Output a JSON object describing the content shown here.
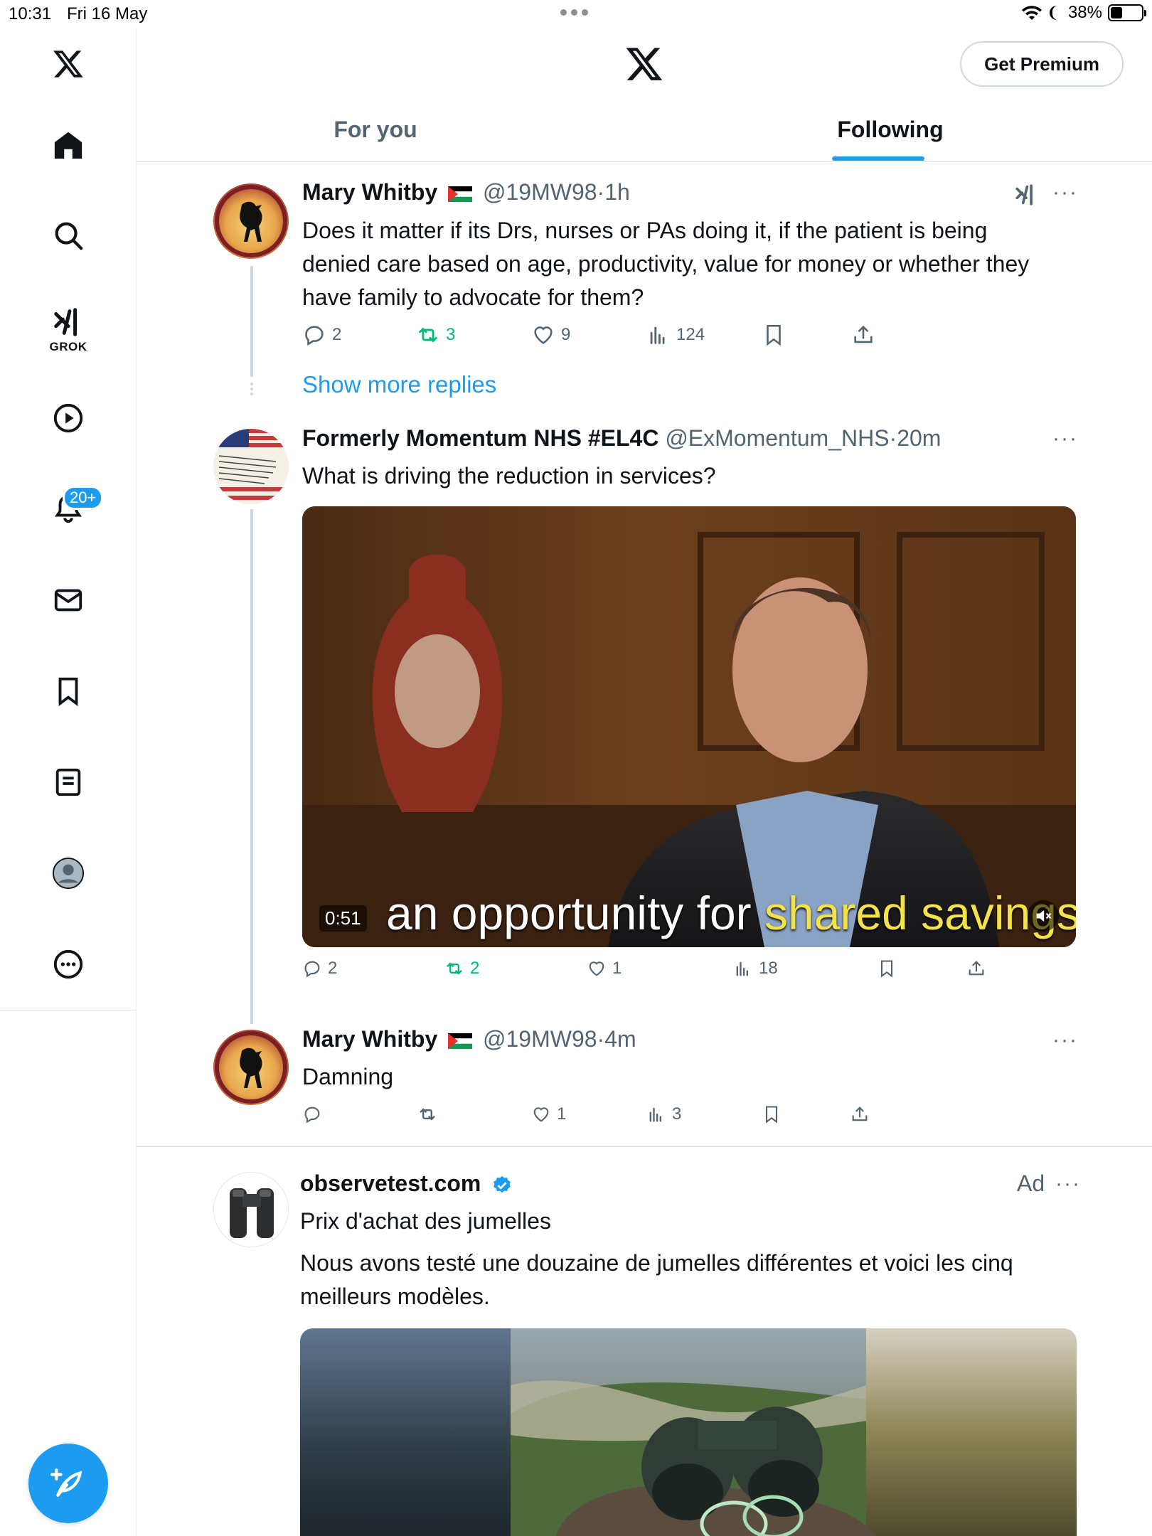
{
  "status_bar": {
    "time": "10:31",
    "date": "Fri 16 May",
    "battery": "38%",
    "battery_level": 0.38
  },
  "sidebar": {
    "grok_label": "GROK",
    "notifications_badge": "20+"
  },
  "header": {
    "premium_button": "Get Premium",
    "tabs": [
      {
        "label": "For you",
        "selected": false
      },
      {
        "label": "Following",
        "selected": true
      }
    ]
  },
  "posts": [
    {
      "name": "Mary Whitby",
      "handle": "@19MW98",
      "time": "1h",
      "text": "Does it matter if its Drs, nurses or PAs doing it, if the patient is being denied care based on age, productivity, value for money or whether they have family to advocate for them?",
      "replies": "2",
      "reposts": "3",
      "likes": "9",
      "views": "124"
    },
    {
      "name": "Formerly Momentum NHS #EL4C",
      "handle": "@ExMomentum_NHS",
      "time": "20m",
      "text": "What is driving the reduction in services?",
      "video_duration": "0:51",
      "video_caption_pre": "an opportunity for ",
      "video_caption_hl": "shared savings",
      "replies": "2",
      "reposts": "2",
      "likes": "1",
      "views": "18"
    },
    {
      "name": "Mary Whitby",
      "handle": "@19MW98",
      "time": "4m",
      "text": "Damning",
      "replies": "",
      "reposts": "",
      "likes": "1",
      "views": "3"
    }
  ],
  "show_more_replies": "Show more replies",
  "ad": {
    "name": "observetest.com",
    "label": "Ad",
    "title": "Prix d'achat des jumelles",
    "text": "Nous avons testé une douzaine de jumelles différentes et voici les cinq meilleurs modèles."
  },
  "colors": {
    "accent": "#1d9bf0",
    "repost": "#00ba7c",
    "muted": "#536471",
    "text": "#0f1419"
  }
}
